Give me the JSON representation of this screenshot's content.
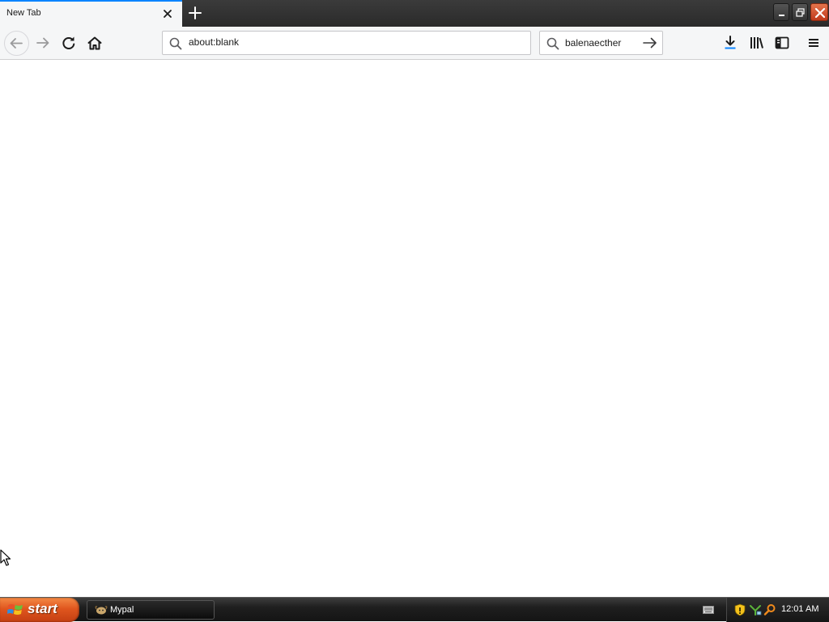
{
  "browser": {
    "tab": {
      "title": "New Tab",
      "close_icon": "close-icon"
    },
    "new_tab_icon": "plus-icon",
    "window_controls": [
      "minimize-icon",
      "restore-icon",
      "close-icon"
    ],
    "toolbar": {
      "back_icon": "arrow-left-icon",
      "forward_icon": "arrow-right-icon",
      "reload_icon": "reload-icon",
      "home_icon": "home-icon",
      "url": {
        "value": "about:blank",
        "icon": "search-icon"
      },
      "search": {
        "value": "balenaecther",
        "icon": "search-icon",
        "go_icon": "arrow-right-icon"
      },
      "right_icons": [
        "download-icon",
        "library-icon",
        "sidebar-icon",
        "hamburger-menu-icon"
      ]
    },
    "accent_color": "#0a84ff"
  },
  "taskbar": {
    "start_label": "start",
    "start_icon": "windows-logo-icon",
    "tasks": [
      {
        "label": "Mypal",
        "icon": "mypal-app-icon"
      }
    ],
    "tray_icons": [
      "keyboard-icon",
      "security-shield-icon",
      "network-icon",
      "search-icon"
    ],
    "clock": "12:01 AM",
    "start_color": "#e0561e"
  }
}
